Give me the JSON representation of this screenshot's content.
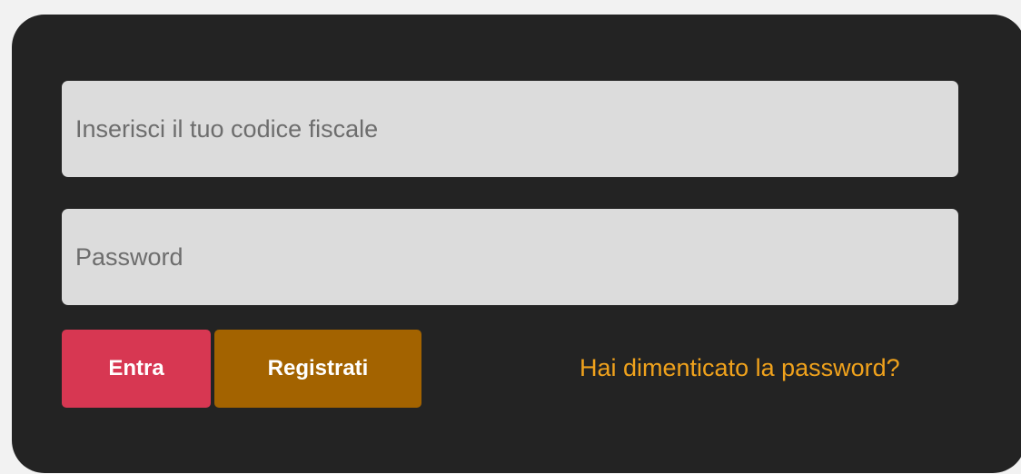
{
  "login": {
    "codice_fiscale": {
      "value": "",
      "placeholder": "Inserisci il tuo codice fiscale"
    },
    "password": {
      "value": "",
      "placeholder": "Password"
    },
    "buttons": {
      "entra_label": "Entra",
      "registrati_label": "Registrati"
    },
    "forgot_password_label": "Hai dimenticato la password?"
  },
  "colors": {
    "page_background": "#f2f2f2",
    "card_background": "#232323",
    "input_background": "#dcdcdc",
    "entra_button": "#d73752",
    "registrati_button": "#a36300",
    "link": "#f0a21c"
  }
}
